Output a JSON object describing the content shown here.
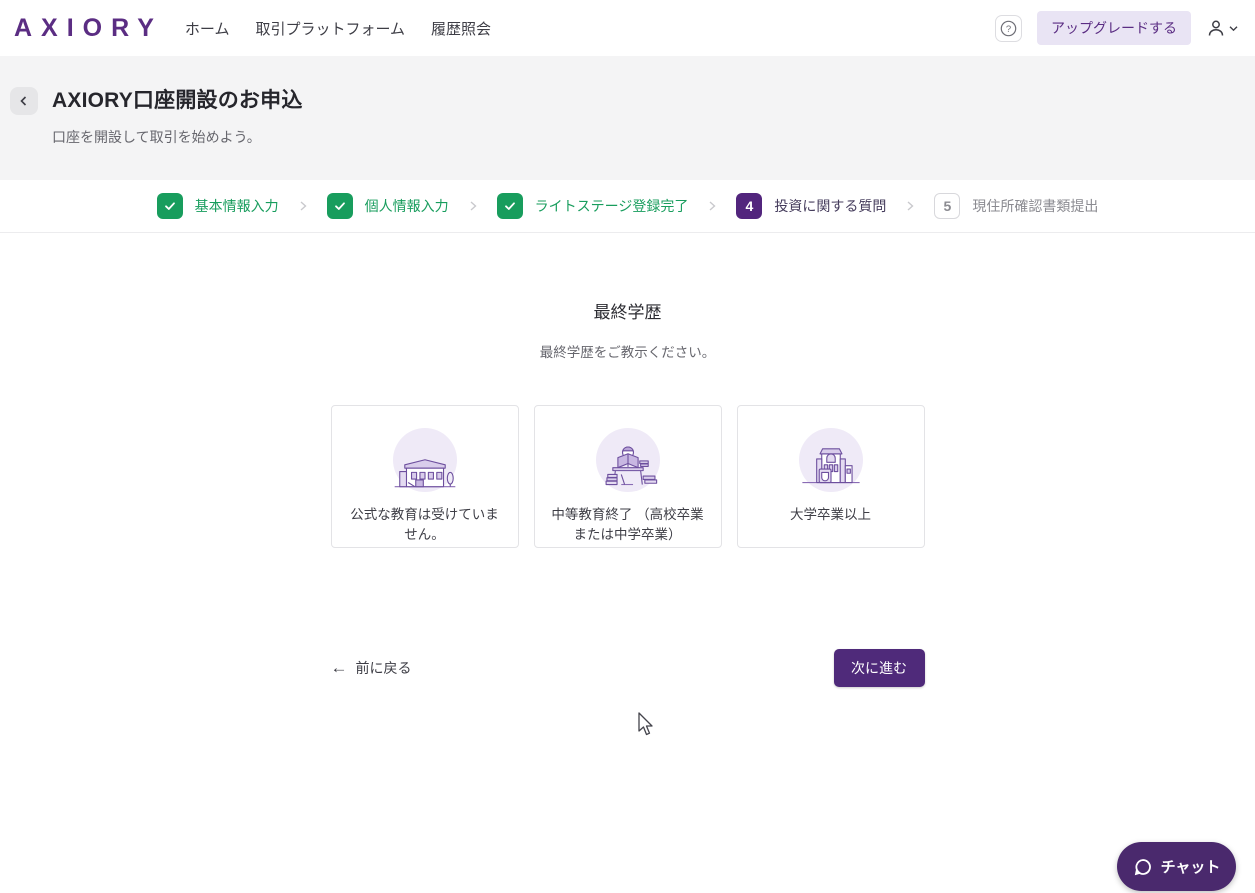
{
  "brand": {
    "logo_text": "AXIORY"
  },
  "nav": {
    "items": [
      {
        "label": "ホーム"
      },
      {
        "label": "取引プラットフォーム"
      },
      {
        "label": "履歴照会"
      }
    ],
    "help_icon": "question-circle-icon",
    "upgrade_label": "アップグレードする",
    "user_icon": "user-avatar-icon"
  },
  "header": {
    "title": "AXIORY口座開設のお申込",
    "subtitle": "口座を開設して取引を始めよう。",
    "back_icon": "chevron-left-icon"
  },
  "stepper": {
    "steps": [
      {
        "label": "基本情報入力",
        "state": "complete",
        "icon": "check-icon"
      },
      {
        "label": "個人情報入力",
        "state": "complete",
        "icon": "check-icon"
      },
      {
        "label": "ライトステージ登録完了",
        "state": "complete",
        "icon": "check-icon"
      },
      {
        "number": "4",
        "label": "投資に関する質問",
        "state": "active"
      },
      {
        "number": "5",
        "label": "現住所確認書類提出",
        "state": "upcoming"
      }
    ]
  },
  "main": {
    "title": "最終学歴",
    "subtitle": "最終学歴をご教示ください。",
    "options": [
      {
        "label": "公式な教育は受けていません。",
        "icon": "school-illustration"
      },
      {
        "label": "中等教育終了 （高校卒業または中学卒業）",
        "icon": "person-reading-illustration"
      },
      {
        "label": "大学卒業以上",
        "icon": "university-illustration"
      }
    ],
    "back_label": "前に戻る",
    "next_label": "次に進む"
  },
  "chat": {
    "label": "チャット",
    "icon": "speech-bubble-icon"
  },
  "colors": {
    "brand_purple": "#5b2d83",
    "button_purple": "#4f2a7a",
    "chat_purple": "#4a296d",
    "step_complete_green": "#189d5d",
    "header_band_gray": "#f4f4f5",
    "upgrade_bg": "#e9e4f4",
    "illustration_bg": "#efeaf7",
    "muted_text": "#66666d"
  }
}
